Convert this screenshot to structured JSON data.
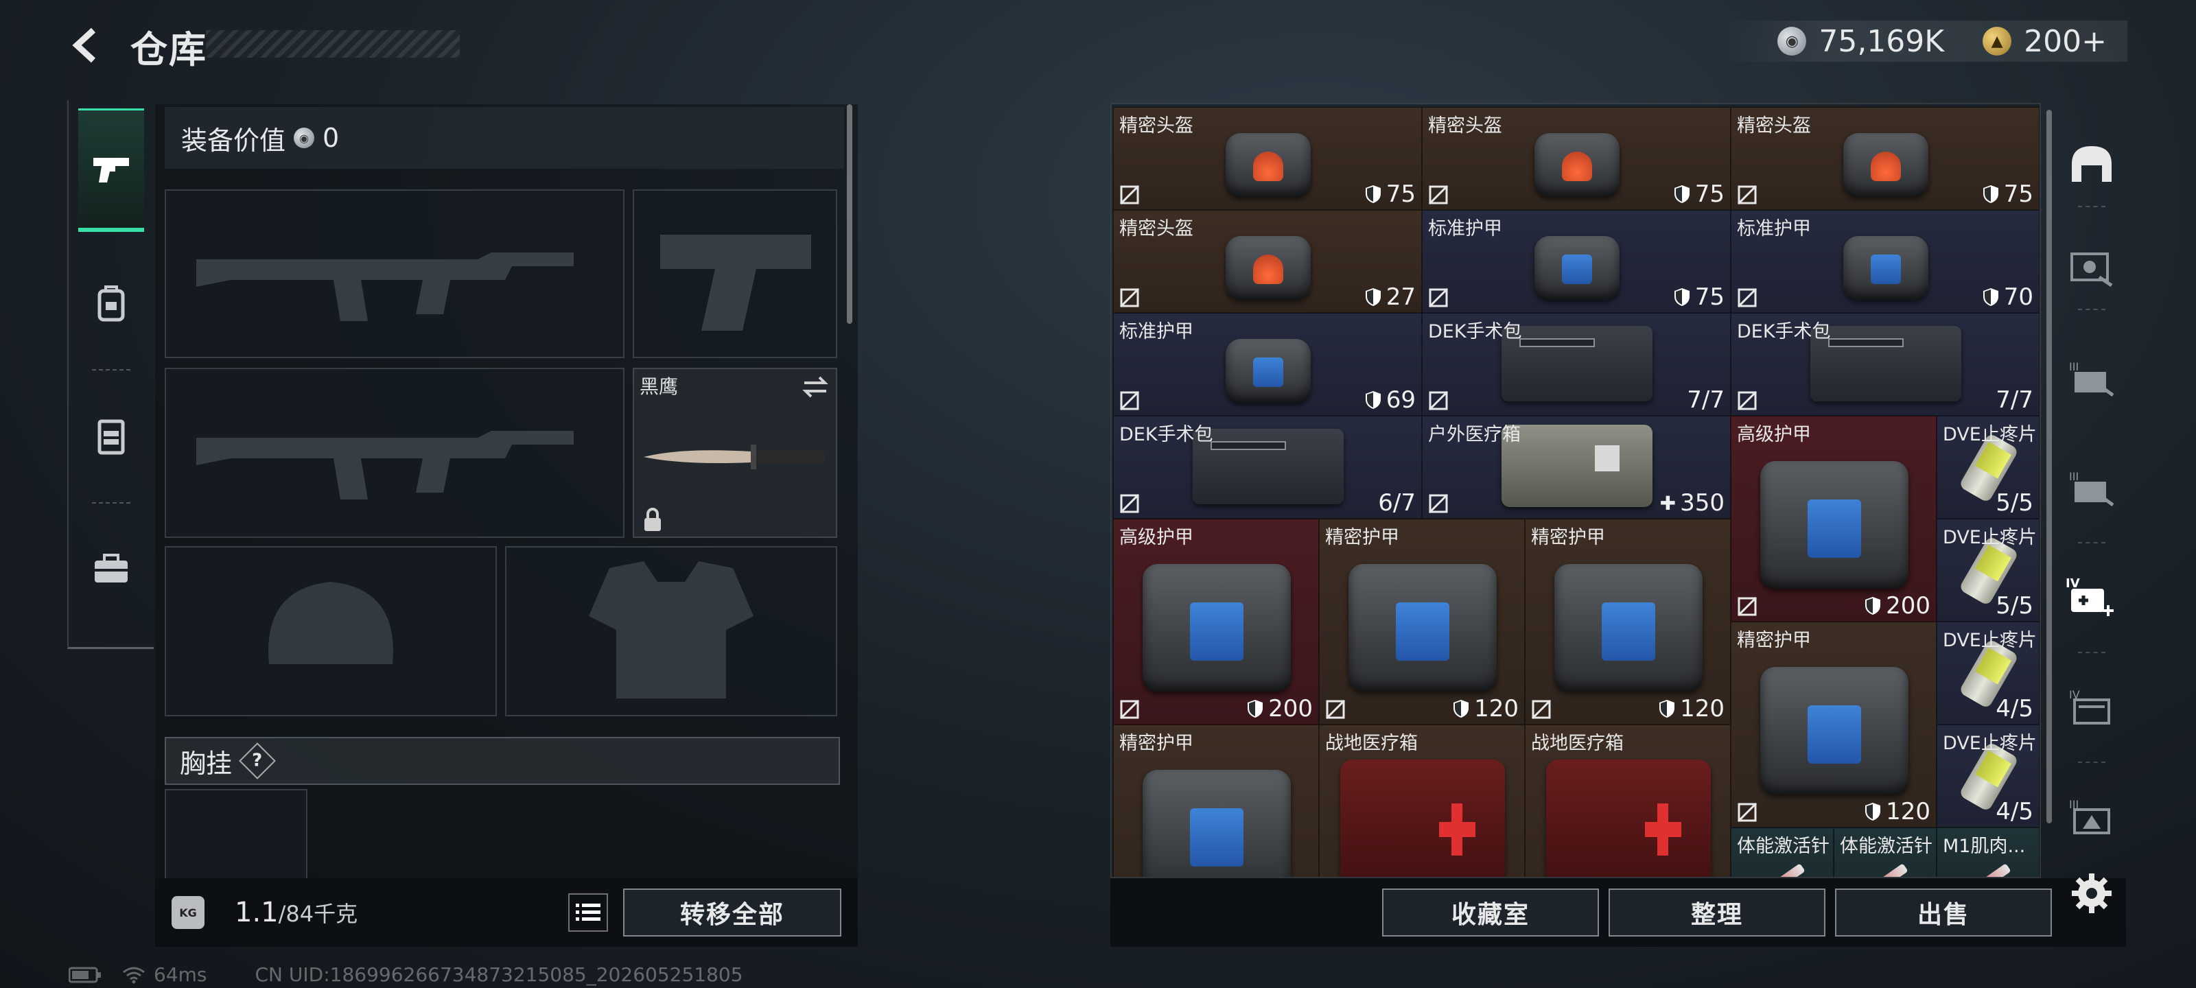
{
  "header": {
    "title": "仓库",
    "currency": {
      "silver": "75,169K",
      "gold": "200+"
    }
  },
  "left_tabs": [
    "weapon-tab",
    "backpack-tab",
    "chest-rig-tab",
    "case-tab"
  ],
  "equipment": {
    "value_label": "装备价值",
    "value": "0",
    "melee_name": "黑鹰",
    "chest_label": "胸挂",
    "chest_help": "?"
  },
  "footer_left": {
    "weight_icon": "KG",
    "weight": "1.1",
    "weight_max": "/84千克",
    "transfer_all": "转移全部"
  },
  "footer_right": {
    "collection": "收藏室",
    "organize": "整理",
    "sell": "出售"
  },
  "status": {
    "ping": "64ms",
    "uid": "CN UID:1869962667348732150​85_202605251805"
  },
  "right_side": [
    "helmet-icon",
    "weapon-case-icon",
    "tier3-crate-icon",
    "tier3-crate-alt-icon",
    "tier4-medical-icon",
    "tier4-crate-icon",
    "tier3-gear-icon"
  ],
  "items": [
    {
      "name": "精密头盔",
      "qty": "75",
      "shield": true,
      "color": "brown"
    },
    {
      "name": "精密头盔",
      "qty": "75",
      "shield": true,
      "color": "brown"
    },
    {
      "name": "精密头盔",
      "qty": "75",
      "shield": true,
      "color": "brown"
    },
    {
      "name": "精密头盔",
      "qty": "27",
      "shield": true,
      "color": "brown"
    },
    {
      "name": "标准护甲",
      "qty": "75",
      "shield": true,
      "color": "navy"
    },
    {
      "name": "标准护甲",
      "qty": "70",
      "shield": true,
      "color": "navy"
    },
    {
      "name": "标准护甲",
      "qty": "69",
      "shield": true,
      "color": "navy"
    },
    {
      "name": "DEK手术包",
      "qty": "7/7",
      "color": "navy"
    },
    {
      "name": "DEK手术包",
      "qty": "7/7",
      "color": "navy"
    },
    {
      "name": "DEK手术包",
      "qty": "6/7",
      "color": "navy"
    },
    {
      "name": "户外医疗箱",
      "qty": "350",
      "plus": true,
      "color": "navy"
    },
    {
      "name": "高级护甲",
      "qty": "200",
      "shield": true,
      "color": "red"
    },
    {
      "name": "DVE止疼片",
      "qty": "5/5",
      "color": "navy"
    },
    {
      "name": "DVE止疼片",
      "qty": "5/5",
      "color": "navy"
    },
    {
      "name": "高级护甲",
      "qty": "200",
      "shield": true,
      "color": "red"
    },
    {
      "name": "精密护甲",
      "qty": "120",
      "shield": true,
      "color": "brown"
    },
    {
      "name": "精密护甲",
      "qty": "120",
      "shield": true,
      "color": "brown"
    },
    {
      "name": "精密护甲",
      "qty": "120",
      "shield": true,
      "color": "brown"
    },
    {
      "name": "DVE止疼片",
      "qty": "4/5",
      "color": "navy"
    },
    {
      "name": "DVE止疼片",
      "qty": "4/5",
      "color": "navy"
    },
    {
      "name": "精密护甲",
      "qty": "",
      "color": "brown"
    },
    {
      "name": "战地医疗箱",
      "qty": "",
      "color": "brown"
    },
    {
      "name": "战地医疗箱",
      "qty": "",
      "color": "brown"
    },
    {
      "name": "体能激活针",
      "qty": "",
      "color": "teal"
    },
    {
      "name": "体能激活针",
      "qty": "",
      "color": "teal"
    },
    {
      "name": "M1肌肉...",
      "qty": "",
      "color": "teal"
    }
  ]
}
